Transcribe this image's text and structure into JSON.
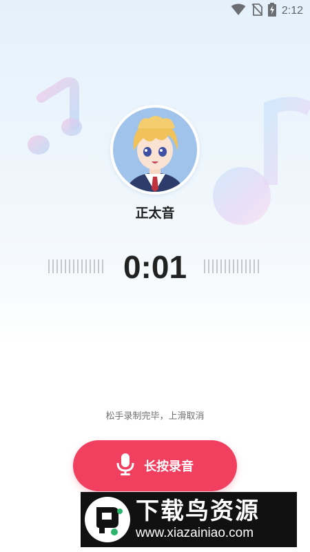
{
  "status_bar": {
    "time": "2:12",
    "icons": [
      "wifi-icon",
      "no-sim-icon",
      "battery-charging-icon"
    ]
  },
  "voice": {
    "name": "正太音",
    "avatar": "anime-boy-avatar"
  },
  "recorder": {
    "elapsed": "0:01",
    "hint": "松手录制完毕，上滑取消",
    "button_label": "长按录音",
    "button_icon": "microphone-icon"
  },
  "watermark": {
    "title": "下载鸟资源",
    "url": "www.xiazainiao.com"
  },
  "colors": {
    "accent": "#f13f60",
    "background_top": "#e4f1fb",
    "text_primary": "#222222",
    "text_hint": "#6f6f6f"
  }
}
